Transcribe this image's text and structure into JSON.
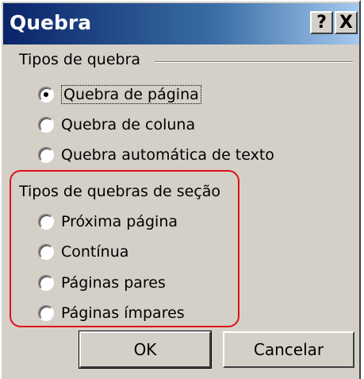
{
  "dialog": {
    "title": "Quebra",
    "help_label": "?",
    "close_label": "X"
  },
  "group_break_types": {
    "label": "Tipos de quebra",
    "options": [
      {
        "label": "Quebra de página",
        "checked": true
      },
      {
        "label": "Quebra de coluna",
        "checked": false
      },
      {
        "label": "Quebra automática de texto",
        "checked": false
      }
    ]
  },
  "group_section_breaks": {
    "label": "Tipos de quebras de seção",
    "options": [
      {
        "label": "Próxima página",
        "checked": false
      },
      {
        "label": "Contínua",
        "checked": false
      },
      {
        "label": "Páginas pares",
        "checked": false
      },
      {
        "label": "Páginas ímpares",
        "checked": false
      }
    ]
  },
  "buttons": {
    "ok_label": "OK",
    "cancel_label": "Cancelar"
  },
  "colors": {
    "highlight": "#e0101a",
    "title_bar_start": "#0a246a",
    "title_bar_end": "#a6caf0",
    "dialog_bg": "#d4d0c8"
  }
}
